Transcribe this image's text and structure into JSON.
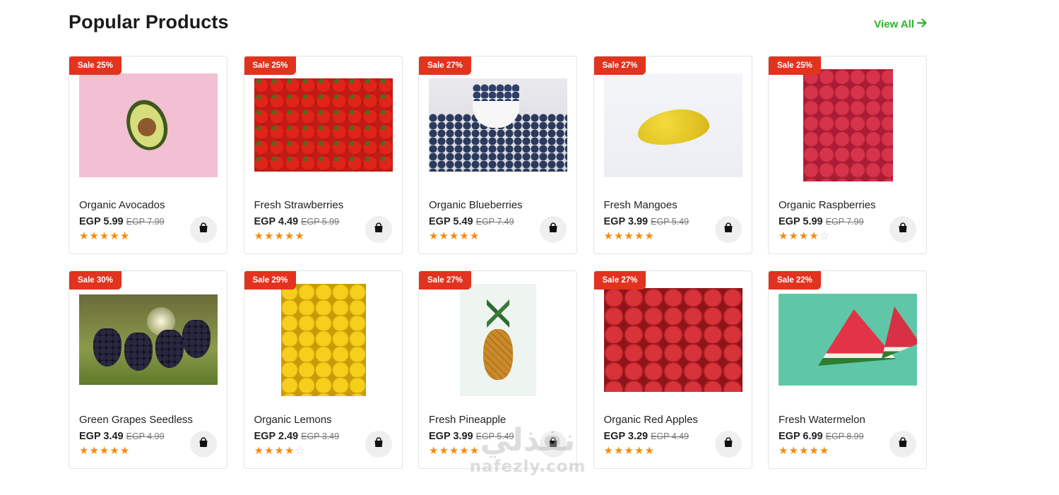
{
  "header": {
    "title": "Popular Products",
    "view_all_label": "View All",
    "view_all_icon": "arrow-right-icon",
    "accent_color": "#2bb32b"
  },
  "sale_badge_color": "#e2331f",
  "star_color": "#f28c0f",
  "products": [
    {
      "sale": "Sale 25%",
      "name": "Organic Avocados",
      "price": "EGP 5.99",
      "old_price": "EGP 7.99",
      "rating": 5,
      "image": "avocado"
    },
    {
      "sale": "Sale 25%",
      "name": "Fresh Strawberries",
      "price": "EGP 4.49",
      "old_price": "EGP 5.99",
      "rating": 5,
      "image": "strawberries"
    },
    {
      "sale": "Sale 27%",
      "name": "Organic Blueberries",
      "price": "EGP 5.49",
      "old_price": "EGP 7.49",
      "rating": 5,
      "image": "blueberries"
    },
    {
      "sale": "Sale 27%",
      "name": "Fresh Mangoes",
      "price": "EGP 3.99",
      "old_price": "EGP 5.49",
      "rating": 5,
      "image": "mango"
    },
    {
      "sale": "Sale 25%",
      "name": "Organic Raspberries",
      "price": "EGP 5.99",
      "old_price": "EGP 7.99",
      "rating": 4,
      "image": "raspberries"
    },
    {
      "sale": "Sale 30%",
      "name": "Green Grapes Seedless",
      "price": "EGP 3.49",
      "old_price": "EGP 4.99",
      "rating": 5,
      "image": "grapes"
    },
    {
      "sale": "Sale 29%",
      "name": "Organic Lemons",
      "price": "EGP 2.49",
      "old_price": "EGP 3.49",
      "rating": 4,
      "image": "lemons"
    },
    {
      "sale": "Sale 27%",
      "name": "Fresh Pineapple",
      "price": "EGP 3.99",
      "old_price": "EGP 5.49",
      "rating": 5,
      "image": "pineapple"
    },
    {
      "sale": "Sale 27%",
      "name": "Organic Red Apples",
      "price": "EGP 3.29",
      "old_price": "EGP 4.49",
      "rating": 5,
      "image": "apples"
    },
    {
      "sale": "Sale 22%",
      "name": "Fresh Watermelon",
      "price": "EGP 6.99",
      "old_price": "EGP 8.99",
      "rating": 5,
      "image": "watermelon"
    }
  ],
  "cart_icon": "shopping-bag-icon",
  "watermark": {
    "arabic": "نفذلي",
    "latin": "nafezly.com"
  }
}
